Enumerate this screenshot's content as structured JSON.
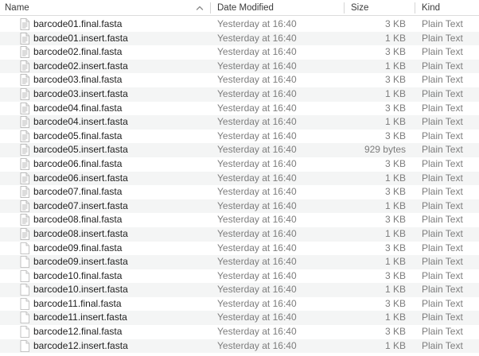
{
  "columns": {
    "name": "Name",
    "date": "Date Modified",
    "size": "Size",
    "kind": "Kind"
  },
  "files": [
    {
      "name": "barcode01.final.fasta",
      "date": "Yesterday at 16:40",
      "size": "3 KB",
      "kind": "Plain Text",
      "icon": "text-document-icon"
    },
    {
      "name": "barcode01.insert.fasta",
      "date": "Yesterday at 16:40",
      "size": "1 KB",
      "kind": "Plain Text",
      "icon": "text-document-icon"
    },
    {
      "name": "barcode02.final.fasta",
      "date": "Yesterday at 16:40",
      "size": "3 KB",
      "kind": "Plain Text",
      "icon": "text-document-icon"
    },
    {
      "name": "barcode02.insert.fasta",
      "date": "Yesterday at 16:40",
      "size": "1 KB",
      "kind": "Plain Text",
      "icon": "text-document-icon"
    },
    {
      "name": "barcode03.final.fasta",
      "date": "Yesterday at 16:40",
      "size": "3 KB",
      "kind": "Plain Text",
      "icon": "text-document-icon"
    },
    {
      "name": "barcode03.insert.fasta",
      "date": "Yesterday at 16:40",
      "size": "1 KB",
      "kind": "Plain Text",
      "icon": "text-document-icon"
    },
    {
      "name": "barcode04.final.fasta",
      "date": "Yesterday at 16:40",
      "size": "3 KB",
      "kind": "Plain Text",
      "icon": "text-document-icon"
    },
    {
      "name": "barcode04.insert.fasta",
      "date": "Yesterday at 16:40",
      "size": "1 KB",
      "kind": "Plain Text",
      "icon": "text-document-icon"
    },
    {
      "name": "barcode05.final.fasta",
      "date": "Yesterday at 16:40",
      "size": "3 KB",
      "kind": "Plain Text",
      "icon": "text-document-icon"
    },
    {
      "name": "barcode05.insert.fasta",
      "date": "Yesterday at 16:40",
      "size": "929 bytes",
      "kind": "Plain Text",
      "icon": "text-document-icon"
    },
    {
      "name": "barcode06.final.fasta",
      "date": "Yesterday at 16:40",
      "size": "3 KB",
      "kind": "Plain Text",
      "icon": "text-document-icon"
    },
    {
      "name": "barcode06.insert.fasta",
      "date": "Yesterday at 16:40",
      "size": "1 KB",
      "kind": "Plain Text",
      "icon": "text-document-icon"
    },
    {
      "name": "barcode07.final.fasta",
      "date": "Yesterday at 16:40",
      "size": "3 KB",
      "kind": "Plain Text",
      "icon": "text-document-icon"
    },
    {
      "name": "barcode07.insert.fasta",
      "date": "Yesterday at 16:40",
      "size": "1 KB",
      "kind": "Plain Text",
      "icon": "text-document-icon"
    },
    {
      "name": "barcode08.final.fasta",
      "date": "Yesterday at 16:40",
      "size": "3 KB",
      "kind": "Plain Text",
      "icon": "text-document-icon"
    },
    {
      "name": "barcode08.insert.fasta",
      "date": "Yesterday at 16:40",
      "size": "1 KB",
      "kind": "Plain Text",
      "icon": "text-document-icon"
    },
    {
      "name": "barcode09.final.fasta",
      "date": "Yesterday at 16:40",
      "size": "3 KB",
      "kind": "Plain Text",
      "icon": "blank-document-icon"
    },
    {
      "name": "barcode09.insert.fasta",
      "date": "Yesterday at 16:40",
      "size": "1 KB",
      "kind": "Plain Text",
      "icon": "blank-document-icon"
    },
    {
      "name": "barcode10.final.fasta",
      "date": "Yesterday at 16:40",
      "size": "3 KB",
      "kind": "Plain Text",
      "icon": "blank-document-icon"
    },
    {
      "name": "barcode10.insert.fasta",
      "date": "Yesterday at 16:40",
      "size": "1 KB",
      "kind": "Plain Text",
      "icon": "blank-document-icon"
    },
    {
      "name": "barcode11.final.fasta",
      "date": "Yesterday at 16:40",
      "size": "3 KB",
      "kind": "Plain Text",
      "icon": "blank-document-icon"
    },
    {
      "name": "barcode11.insert.fasta",
      "date": "Yesterday at 16:40",
      "size": "1 KB",
      "kind": "Plain Text",
      "icon": "blank-document-icon"
    },
    {
      "name": "barcode12.final.fasta",
      "date": "Yesterday at 16:40",
      "size": "3 KB",
      "kind": "Plain Text",
      "icon": "blank-document-icon"
    },
    {
      "name": "barcode12.insert.fasta",
      "date": "Yesterday at 16:40",
      "size": "1 KB",
      "kind": "Plain Text",
      "icon": "blank-document-icon"
    }
  ]
}
